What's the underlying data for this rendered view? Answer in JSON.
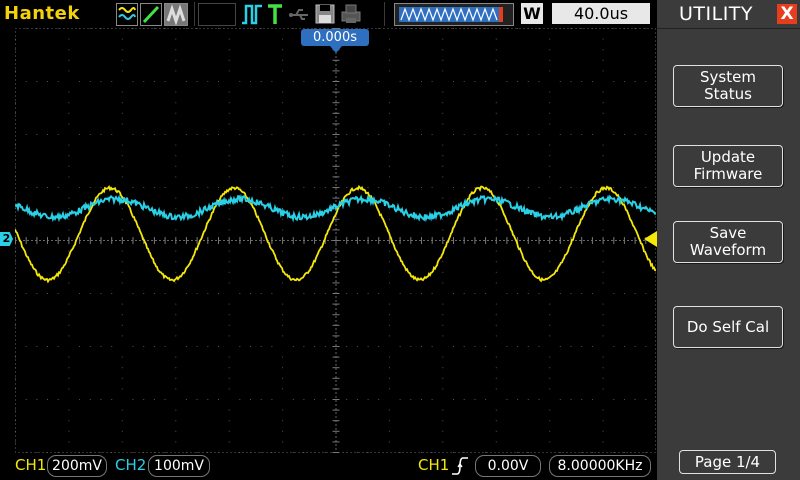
{
  "brand": "Hantek",
  "topbar": {
    "timebase": "40.0us",
    "window_label": "W",
    "trigger_time": "0.000s"
  },
  "menu": {
    "title": "UTILITY",
    "close": "X",
    "buttons": [
      {
        "line1": "System",
        "line2": "Status"
      },
      {
        "line1": "Update",
        "line2": "Firmware"
      },
      {
        "line1": "Save",
        "line2": "Waveform"
      },
      {
        "line1": "Do Self Cal",
        "line2": ""
      }
    ],
    "page": "Page 1/4"
  },
  "bottombar": {
    "ch1_label": "CH1",
    "ch1_scale": "200mV",
    "ch2_label": "CH2",
    "ch2_scale": "100mV",
    "trig_source": "CH1",
    "trig_level": "0.00V",
    "frequency": "8.00000KHz"
  },
  "markers": {
    "ch2": "2"
  },
  "colors": {
    "ch1": "#f4e80a",
    "ch2": "#2ad0e6",
    "brand": "#f4d20a",
    "accent_red": "#e53d1e",
    "panel": "#3b3b3b",
    "trigger_marker": "#2f6fbf"
  },
  "icons": {
    "waveform_mode": "wave-icon",
    "run": "square-pulse-icon",
    "trigger": "t-icon",
    "usb": "usb-icon",
    "save": "floppy-icon",
    "print": "printer-icon",
    "memory_bar": "memory-bar-icon"
  }
}
